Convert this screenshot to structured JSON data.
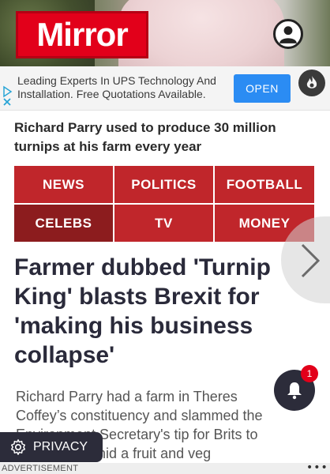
{
  "header": {
    "logo": "Mirror",
    "account_icon": "user-icon"
  },
  "ad_banner": {
    "text_line1": "Leading Experts In UPS Technology And",
    "text_line2": "Installation. Free Quotations Available.",
    "cta": "OPEN",
    "adchoices_icon": "adchoices-icon",
    "brand_icon": "flame-icon"
  },
  "caption": "Richard Parry used to produce 30 million turnips at his farm every year",
  "nav": {
    "items": [
      {
        "label": "NEWS"
      },
      {
        "label": "POLITICS"
      },
      {
        "label": "FOOTBALL"
      },
      {
        "label": "CELEBS"
      },
      {
        "label": "TV"
      },
      {
        "label": "MONEY"
      }
    ],
    "active": "CELEBS"
  },
  "headline": {
    "line1": "Farmer dubbed 'Turnip",
    "line2": "King' blasts Brexit for",
    "line3": "'making his business",
    "line4": "collapse'"
  },
  "standfirst": {
    "line1": "Richard Parry had a farm in Theres",
    "line2": "Coffey’s constituency and slammed the",
    "line3": "Environment Secretary's tip for Brits to",
    "line4": "eat turnips amid a fruit and veg"
  },
  "notifications": {
    "icon": "bell-icon",
    "count": "1"
  },
  "privacy": {
    "label": "PRIVACY",
    "icon": "gear-icon"
  },
  "ad_strip": {
    "label": "ADVERTISEMENT",
    "more": "•••"
  },
  "colors": {
    "brand_red": "#e2001a",
    "nav_red": "#c0262b",
    "nav_active": "#8c1c1e",
    "dark": "#2c2c3a",
    "cta_blue": "#2b8cf3"
  }
}
